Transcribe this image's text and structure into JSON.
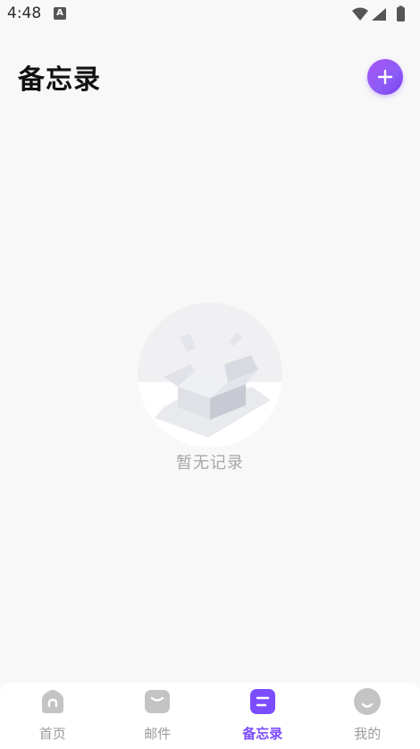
{
  "status_bar": {
    "time": "4:48",
    "notification_badge": "A"
  },
  "header": {
    "title": "备忘录"
  },
  "empty_state": {
    "message": "暂无记录"
  },
  "bottom_nav": {
    "items": [
      {
        "label": "首页",
        "icon": "home-icon",
        "active": false
      },
      {
        "label": "邮件",
        "icon": "mail-icon",
        "active": false
      },
      {
        "label": "备忘录",
        "icon": "memo-icon",
        "active": true
      },
      {
        "label": "我的",
        "icon": "profile-icon",
        "active": false
      }
    ]
  },
  "colors": {
    "accent": "#8b5cf6",
    "active_nav": "#7c4dff",
    "inactive_nav": "#9b9b9b",
    "background": "#f8f8f8"
  }
}
